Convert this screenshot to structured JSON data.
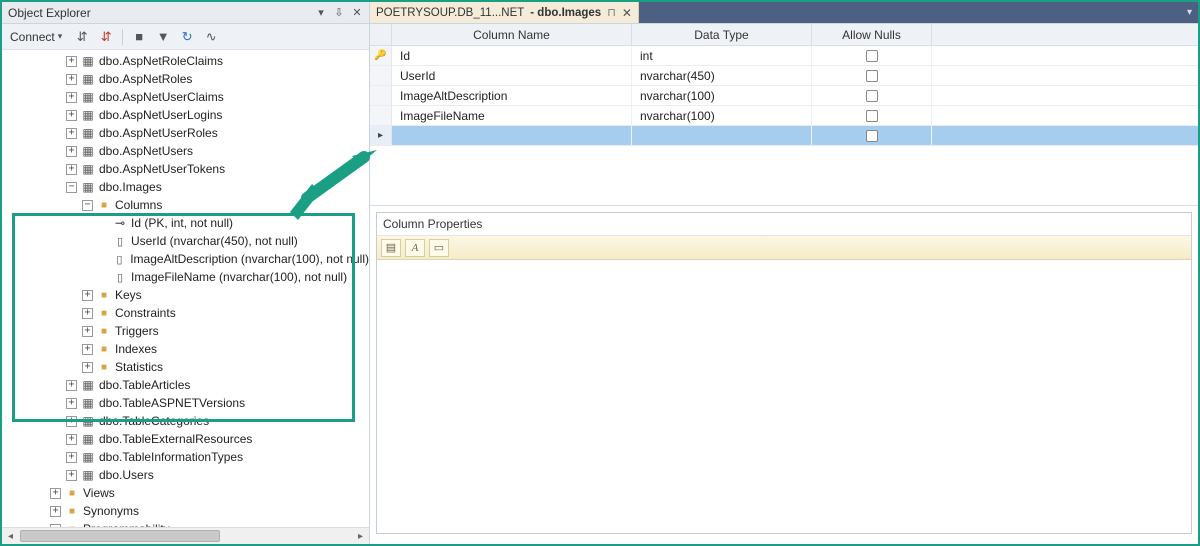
{
  "objectExplorer": {
    "title": "Object Explorer",
    "connectLabel": "Connect",
    "tables": [
      "dbo.AspNetRoleClaims",
      "dbo.AspNetRoles",
      "dbo.AspNetUserClaims",
      "dbo.AspNetUserLogins",
      "dbo.AspNetUserRoles",
      "dbo.AspNetUsers",
      "dbo.AspNetUserTokens"
    ],
    "imagesTable": {
      "name": "dbo.Images",
      "columnsFolder": "Columns",
      "columns": [
        "Id (PK, int, not null)",
        "UserId (nvarchar(450), not null)",
        "ImageAltDescription (nvarchar(100), not null)",
        "ImageFileName (nvarchar(100), not null)"
      ],
      "folders": [
        "Keys",
        "Constraints",
        "Triggers",
        "Indexes",
        "Statistics"
      ]
    },
    "afterTables": [
      "dbo.TableArticles",
      "dbo.TableASPNETVersions",
      "dbo.TableCategories",
      "dbo.TableExternalResources",
      "dbo.TableInformationTypes",
      "dbo.Users"
    ],
    "bottomFolders": [
      "Views",
      "Synonyms",
      "Programmability"
    ]
  },
  "docTab": {
    "part1": "POETRYSOUP.DB_11...NET",
    "part2": "- dbo.Images"
  },
  "designer": {
    "headers": {
      "name": "Column Name",
      "type": "Data Type",
      "null": "Allow Nulls"
    },
    "rows": [
      {
        "pk": true,
        "name": "Id",
        "type": "int",
        "allowNulls": false
      },
      {
        "pk": false,
        "name": "UserId",
        "type": "nvarchar(450)",
        "allowNulls": false
      },
      {
        "pk": false,
        "name": "ImageAltDescription",
        "type": "nvarchar(100)",
        "allowNulls": false
      },
      {
        "pk": false,
        "name": "ImageFileName",
        "type": "nvarchar(100)",
        "allowNulls": false
      }
    ]
  },
  "columnProperties": {
    "title": "Column Properties"
  }
}
